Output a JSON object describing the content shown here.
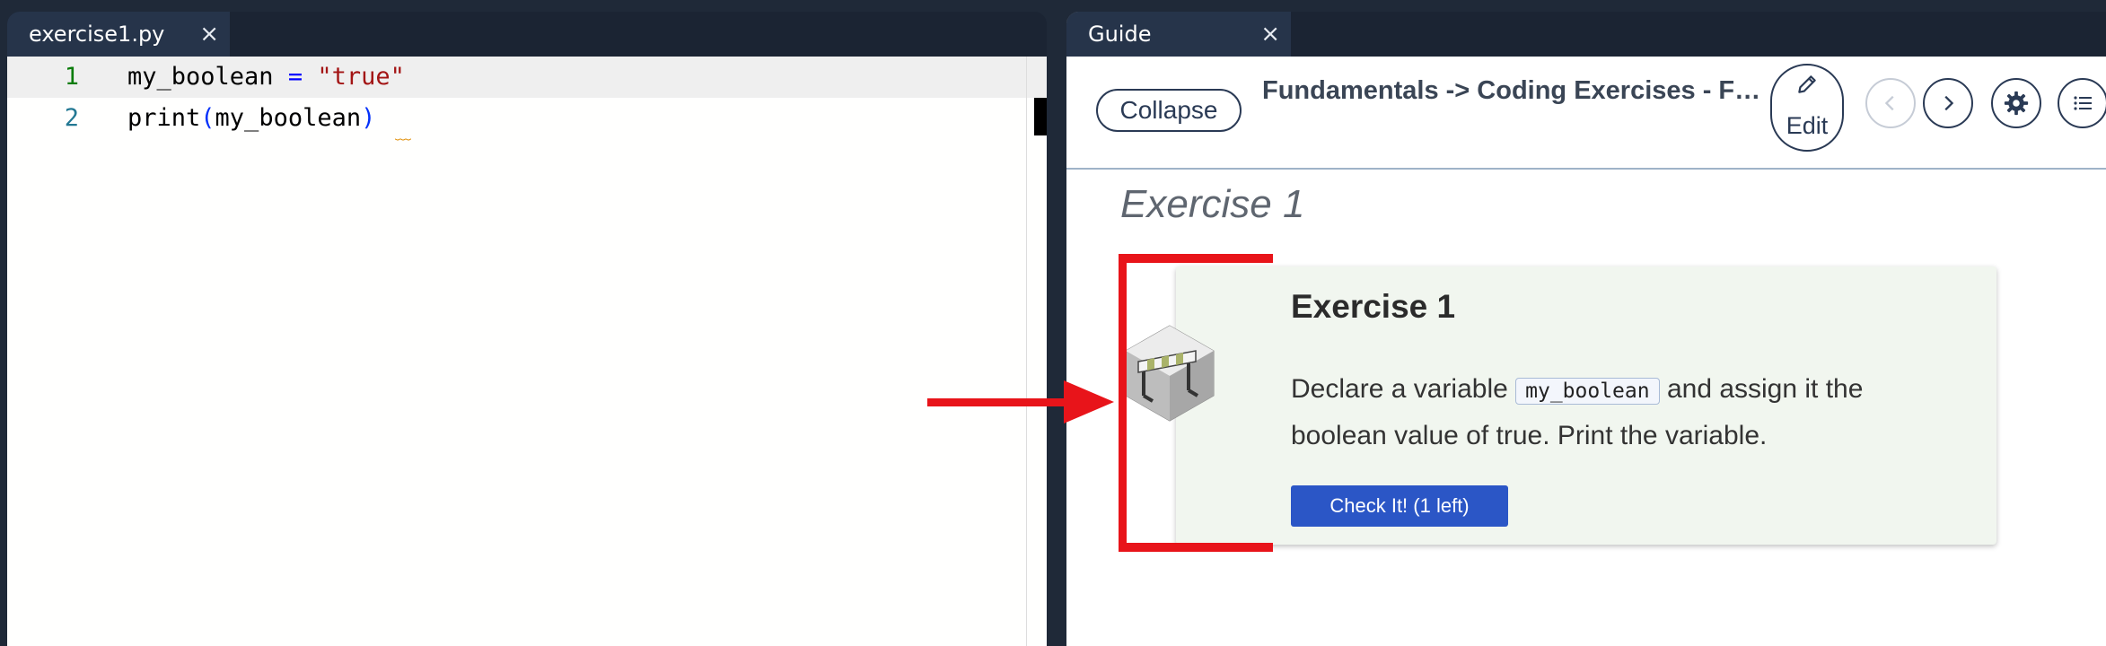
{
  "editor": {
    "tab_label": "exercise1.py",
    "tab_close": "×",
    "lines": [
      {
        "number": "1",
        "tokens": {
          "var": "my_boolean",
          "op": " = ",
          "str": "\"true\""
        }
      },
      {
        "number": "2",
        "tokens": {
          "fn": "print",
          "open": "(",
          "arg": "my_boolean",
          "close": ")"
        }
      }
    ]
  },
  "guide": {
    "tab_label": "Guide",
    "tab_close": "×",
    "toolbar": {
      "collapse_label": "Collapse",
      "title": "Fundamentals -> Coding Exercises - Fu...",
      "edit_label": "Edit"
    },
    "section_heading": "Exercise 1",
    "card": {
      "title": "Exercise 1",
      "desc_before": "Declare a variable ",
      "desc_code": "my_boolean",
      "desc_after": " and assign it the boolean value of true. Print the variable.",
      "check_label": "Check It! (1 left)"
    }
  },
  "colors": {
    "accent": "#2b56c6",
    "annotation": "#e8141a",
    "card_bg": "#f1f6ef",
    "dark_bg": "#1f2938"
  },
  "icons": [
    "close-icon",
    "pencil-icon",
    "chevron-left-icon",
    "chevron-right-icon",
    "gear-icon",
    "list-icon",
    "hurdle-icon",
    "red-arrow-icon"
  ]
}
